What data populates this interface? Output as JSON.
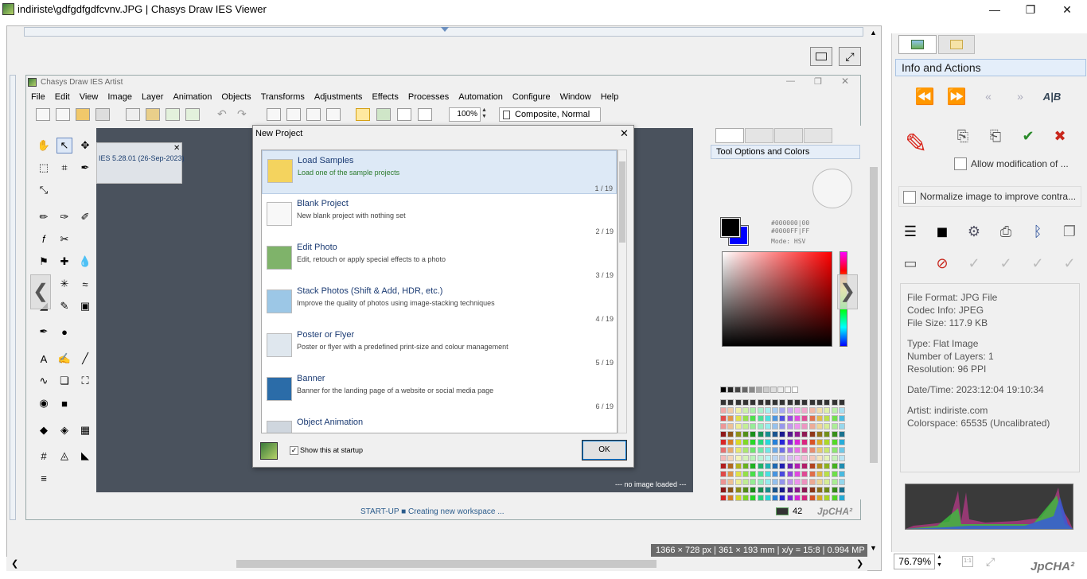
{
  "window": {
    "title": "indiriste\\gdfgdfgdfcvnv.JPG | Chasys Draw IES Viewer",
    "minimize": "—",
    "maximize": "❐",
    "close": "✕"
  },
  "artist": {
    "title": "Chasys Draw IES Artist",
    "menu": [
      "File",
      "Edit",
      "View",
      "Image",
      "Layer",
      "Animation",
      "Objects",
      "Transforms",
      "Adjustments",
      "Effects",
      "Processes",
      "Automation",
      "Configure",
      "Window",
      "Help"
    ],
    "zoom": "100%",
    "blend_mode": "Composite, Normal",
    "info_popup": "IES 5.28.01 (26-Sep-2023)",
    "canvas_status": "--- no image loaded ---",
    "status_text": "START-UP ■ Creating new workspace ...",
    "status_number": "42",
    "brand": "JpCHA²"
  },
  "dialog": {
    "title": "New Project",
    "items": [
      {
        "name": "Load Samples",
        "desc": "Load one of the sample projects",
        "index": "1 / 19"
      },
      {
        "name": "Blank Project",
        "desc": "New blank project with nothing set",
        "index": "2 / 19"
      },
      {
        "name": "Edit Photo",
        "desc": "Edit, retouch or apply special effects to a photo",
        "index": "3 / 19"
      },
      {
        "name": "Stack Photos (Shift & Add, HDR, etc.)",
        "desc": "Improve the quality of photos using image-stacking techniques",
        "index": "4 / 19"
      },
      {
        "name": "Poster or Flyer",
        "desc": "Poster or flyer with a predefined print-size and colour management",
        "index": "5 / 19"
      },
      {
        "name": "Banner",
        "desc": "Banner for the landing page of a website or social media page",
        "index": "6 / 19"
      },
      {
        "name": "Object Animation",
        "desc": "",
        "index": ""
      }
    ],
    "show_at_startup": "Show this at startup",
    "ok": "OK"
  },
  "tool_options": {
    "title": "Tool Options and Colors",
    "color_text": [
      "#000000|00",
      "#0000FF|FF",
      "Mode: HSV"
    ]
  },
  "sidebar": {
    "header": "Info and Actions",
    "ab_label": "A|B",
    "allow_mod": "Allow modification of ...",
    "normalize": "Normalize image to improve contra...",
    "info": {
      "format": "File Format:  JPG File",
      "codec": "Codec Info:  JPEG",
      "size": "File Size:  117.9 KB",
      "type": "Type:  Flat Image",
      "layers": "Number of Layers:  1",
      "resolution": "Resolution:  96 PPI",
      "datetime": "Date/Time:  2023:12:04 19:10:34",
      "artist": "Artist:  indiriste.com",
      "colorspace": "Colorspace:  65535 (Uncalibrated)"
    },
    "zoom": "76.79%",
    "brand": "JpCHA²"
  },
  "viewer_status": "1366 × 728 px | 361 × 193 mm | x/y = 15:8 | 0.994 MP"
}
